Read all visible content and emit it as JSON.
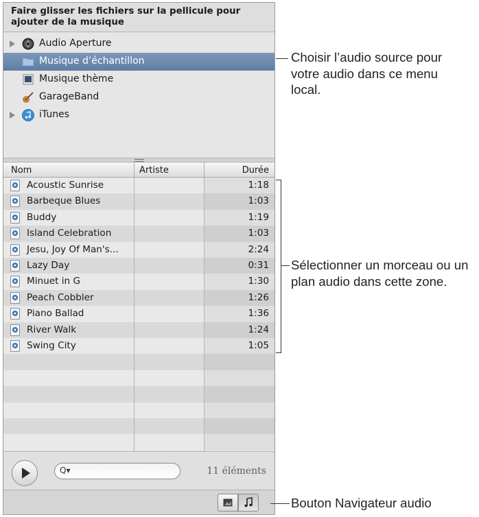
{
  "header": {
    "instruction": "Faire glisser les fichiers sur la pellicule pour ajouter de la musique"
  },
  "sources": [
    {
      "label": "Audio Aperture",
      "icon": "aperture-icon",
      "disclosure": true,
      "selected": false
    },
    {
      "label": "Musique d’échantillon",
      "icon": "folder-icon",
      "disclosure": false,
      "selected": true
    },
    {
      "label": "Musique thème",
      "icon": "theme-music-icon",
      "disclosure": false,
      "selected": false
    },
    {
      "label": "GarageBand",
      "icon": "guitar-icon",
      "disclosure": false,
      "selected": false
    },
    {
      "label": "iTunes",
      "icon": "itunes-icon",
      "disclosure": true,
      "selected": false
    }
  ],
  "table": {
    "columns": {
      "name": "Nom",
      "artist": "Artiste",
      "duration": "Durée"
    },
    "rows": [
      {
        "name": "Acoustic Sunrise",
        "artist": "",
        "duration": "1:18"
      },
      {
        "name": "Barbeque Blues",
        "artist": "",
        "duration": "1:03"
      },
      {
        "name": "Buddy",
        "artist": "",
        "duration": "1:19"
      },
      {
        "name": "Island Celebration",
        "artist": "",
        "duration": "1:03"
      },
      {
        "name": "Jesu, Joy Of Man's...",
        "artist": "",
        "duration": "2:24"
      },
      {
        "name": "Lazy Day",
        "artist": "",
        "duration": "0:31"
      },
      {
        "name": "Minuet in G",
        "artist": "",
        "duration": "1:30"
      },
      {
        "name": "Peach Cobbler",
        "artist": "",
        "duration": "1:26"
      },
      {
        "name": "Piano Ballad",
        "artist": "",
        "duration": "1:36"
      },
      {
        "name": "River Walk",
        "artist": "",
        "duration": "1:24"
      },
      {
        "name": "Swing City",
        "artist": "",
        "duration": "1:05"
      }
    ]
  },
  "bottom": {
    "count": "11 éléments",
    "search_glyph": "Q▾"
  },
  "callouts": {
    "source_menu": "Choisir l’audio source pour votre audio dans ce menu local.",
    "track_area": "Sélectionner un morceau ou un plan audio dans cette zone.",
    "audio_button": "Bouton Navigateur audio"
  },
  "colors": {
    "selection": "#6b89ae",
    "panel": "#e4e4e4",
    "row_alt": "#d9d9d9"
  }
}
